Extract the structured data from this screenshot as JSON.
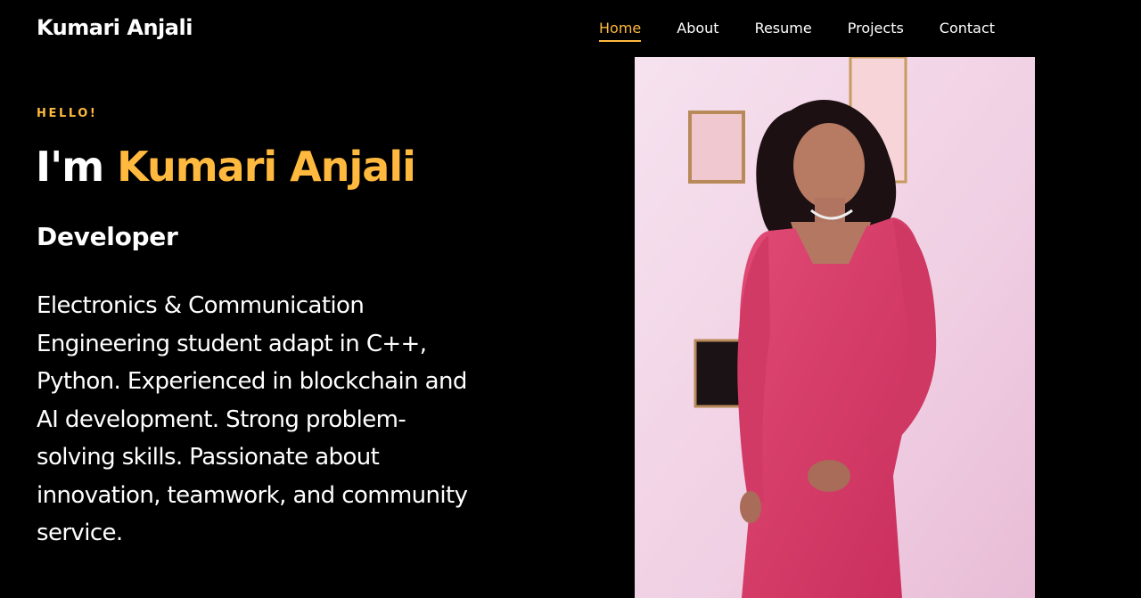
{
  "header": {
    "brand": "Kumari Anjali",
    "nav": [
      {
        "label": "Home",
        "active": true
      },
      {
        "label": "About",
        "active": false
      },
      {
        "label": "Resume",
        "active": false
      },
      {
        "label": "Projects",
        "active": false
      },
      {
        "label": "Contact",
        "active": false
      }
    ]
  },
  "hero": {
    "greeting": "HELLO!",
    "intro": "I'm",
    "name": "Kumari Anjali",
    "role": "Developer",
    "bio": "Electronics & Communication Engineering student adapt in C++, Python. Experienced in blockchain and AI development. Strong problem-solving skills. Passionate about innovation, teamwork, and community service."
  },
  "colors": {
    "background": "#000000",
    "accent": "#ffb93e",
    "text": "#ffffff"
  }
}
